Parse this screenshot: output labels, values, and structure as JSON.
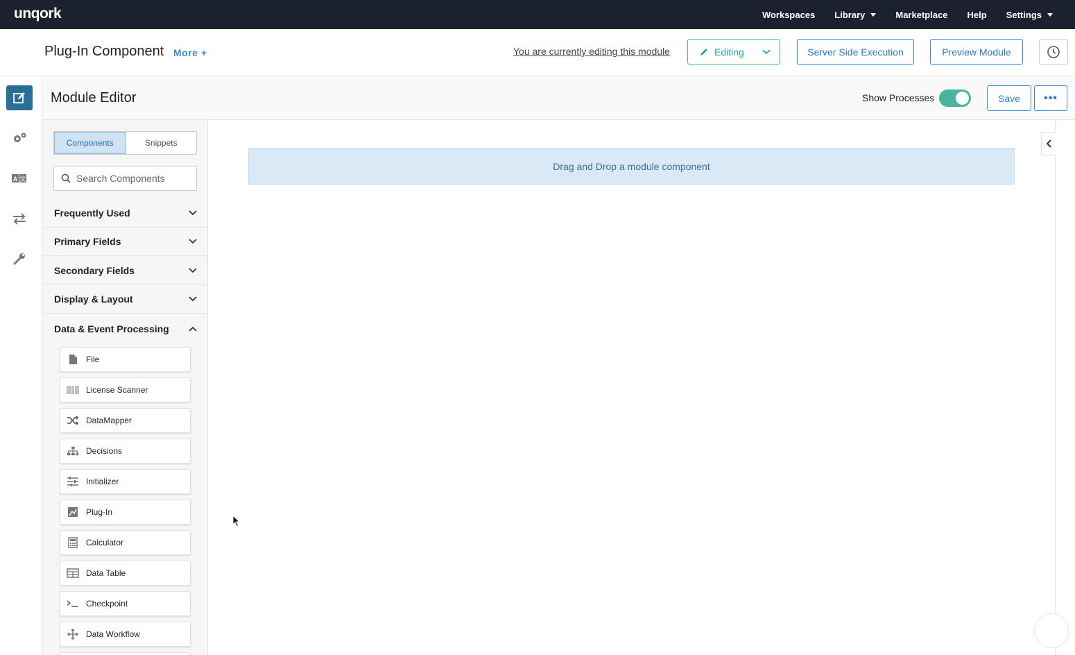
{
  "brand": {
    "logo": "unqork"
  },
  "topnav": {
    "items": [
      {
        "label": "Workspaces",
        "has_caret": false
      },
      {
        "label": "Library",
        "has_caret": true
      },
      {
        "label": "Marketplace",
        "has_caret": false
      },
      {
        "label": "Help",
        "has_caret": false
      },
      {
        "label": "Settings",
        "has_caret": true
      }
    ]
  },
  "header": {
    "title": "Plug-In Component",
    "more_label": "More +",
    "editing_note": "You are currently editing this module",
    "editing_button": "Editing",
    "sse_button": "Server Side Execution",
    "preview_button": "Preview Module"
  },
  "rail": {
    "items": [
      "edit-icon",
      "settings-gears-icon",
      "translate-icon",
      "transfer-arrows-icon",
      "wrench-icon"
    ],
    "active": "edit-icon"
  },
  "editor": {
    "title": "Module Editor",
    "show_processes_label": "Show Processes",
    "show_processes_on": true,
    "save_label": "Save",
    "more_actions_label": "•••"
  },
  "panel": {
    "tabs": {
      "components": "Components",
      "snippets": "Snippets",
      "active": "components"
    },
    "search_placeholder": "Search Components",
    "sections": [
      {
        "label": "Frequently Used",
        "expanded": false
      },
      {
        "label": "Primary Fields",
        "expanded": false
      },
      {
        "label": "Secondary Fields",
        "expanded": false
      },
      {
        "label": "Display & Layout",
        "expanded": false
      },
      {
        "label": "Data & Event Processing",
        "expanded": true
      }
    ],
    "components": [
      {
        "label": "File",
        "icon": "file-icon"
      },
      {
        "label": "License Scanner",
        "icon": "barcode-icon"
      },
      {
        "label": "DataMapper",
        "icon": "shuffle-icon"
      },
      {
        "label": "Decisions",
        "icon": "sitemap-icon"
      },
      {
        "label": "Initializer",
        "icon": "sliders-icon"
      },
      {
        "label": "Plug-In",
        "icon": "plugin-icon"
      },
      {
        "label": "Calculator",
        "icon": "calculator-icon"
      },
      {
        "label": "Data Table",
        "icon": "table-icon"
      },
      {
        "label": "Checkpoint",
        "icon": "terminal-icon"
      },
      {
        "label": "Data Workflow",
        "icon": "move-arrows-icon"
      }
    ]
  },
  "canvas": {
    "dropzone_text": "Drag and Drop a module component"
  },
  "colors": {
    "topnav_bg": "#1c2130",
    "accent_blue": "#3b8bd6",
    "rail_active": "#2a6f97",
    "toggle_on": "#48b59c",
    "editing_teal": "#2aa4a4",
    "dropzone_bg": "#d9e9f5"
  }
}
